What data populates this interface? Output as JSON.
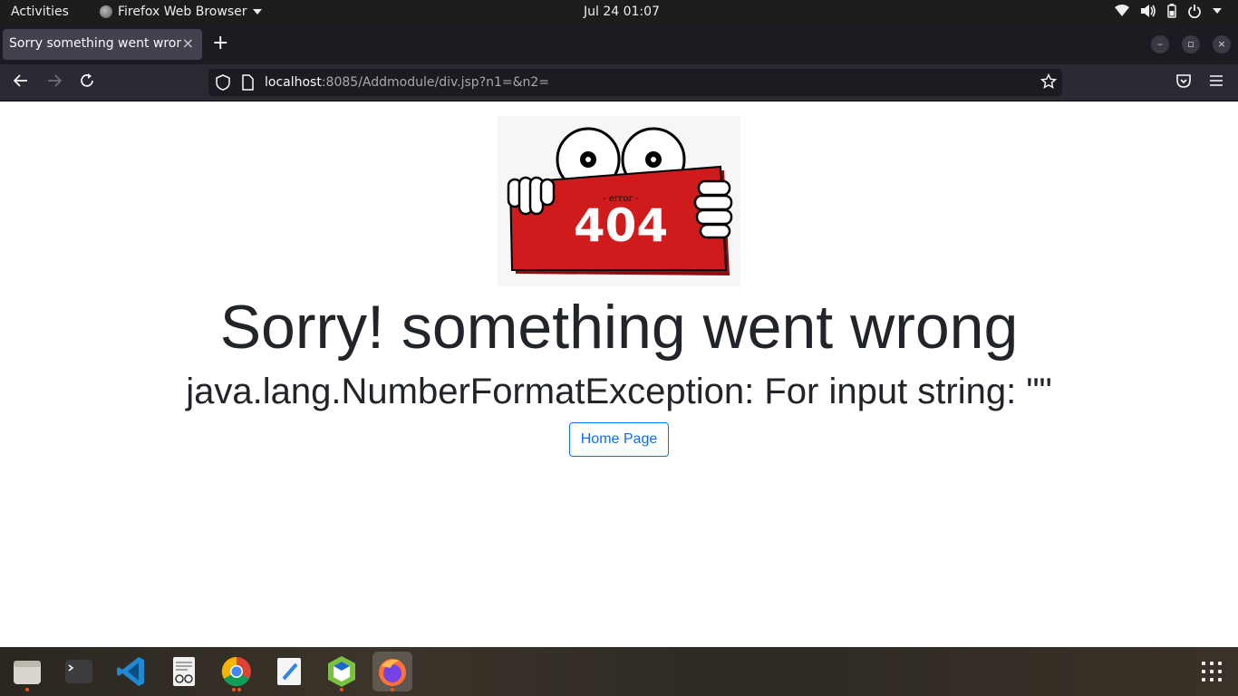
{
  "topbar": {
    "activities": "Activities",
    "app_name": "Firefox Web Browser",
    "clock": "Jul 24  01:07",
    "tray_icons": [
      "wifi-icon",
      "volume-icon",
      "battery-icon",
      "power-icon"
    ]
  },
  "tabs": [
    {
      "title": "Sorry something went wrong",
      "close": "×"
    }
  ],
  "tabstrip": {
    "new_tab": "+"
  },
  "window_controls": {
    "minimize": "–",
    "maximize": "▫",
    "close": "×"
  },
  "navbar": {
    "url_host": "localhost",
    "url_rest": ":8085/Addmodule/div.jsp?n1=&n2="
  },
  "page": {
    "image": {
      "small_text": "- error -",
      "big_text": "404",
      "colors": {
        "card": "#cf1b1b",
        "card_shadow": "#8a1010"
      }
    },
    "headline": "Sorry! something went wrong",
    "error_message": "java.lang.NumberFormatException: For input string: \"\"",
    "home_button": "Home Page"
  },
  "dock": {
    "apps": [
      "files-icon",
      "terminal-icon",
      "vscode-icon",
      "document-viewer-icon",
      "chrome-icon",
      "text-editor-icon",
      "netbeans-icon",
      "firefox-icon"
    ],
    "show_apps": "show-applications-icon"
  },
  "colors": {
    "accent": "#0d6efd",
    "text": "#212529",
    "ubuntu_orange": "#e95420"
  }
}
